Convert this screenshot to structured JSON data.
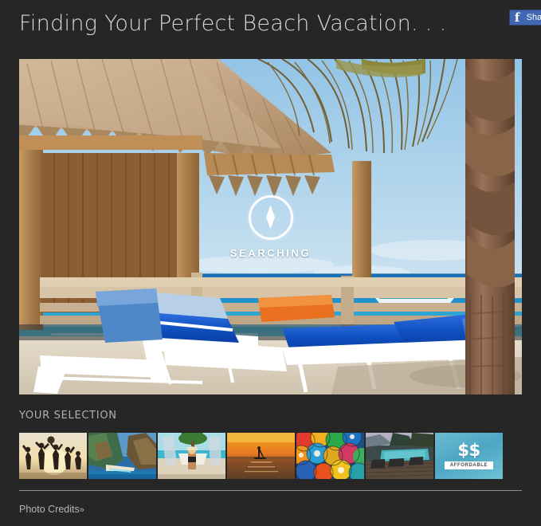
{
  "page": {
    "background_color": "#262626",
    "text_color": "#d8d8d8"
  },
  "header": {
    "title": "Finding Your Perfect Beach Vacation. . .",
    "share": {
      "network": "facebook",
      "icon_glyph": "f",
      "label": "Share"
    }
  },
  "hero": {
    "alt": "Thatched-roof beach cabana with blue and white lounge chairs, palm tree and cruise ship on turquoise Caribbean water",
    "status_overlay": {
      "icon": "compass-icon",
      "label": "SEARCHING"
    },
    "colors": {
      "sky": "#a8cfe8",
      "ocean_deep": "#1a7fc0",
      "ocean_shallow": "#44b9d8",
      "sand": "#ded3c2",
      "thatch": "#c3a583",
      "wood": "#b08352",
      "chair_blue": "#1156c4"
    }
  },
  "selection": {
    "heading": "YOUR SELECTION",
    "thumbnails": [
      {
        "name": "beach-volleyball",
        "caption": "Beach volleyball at sunset"
      },
      {
        "name": "coastal-cliffs",
        "caption": "Green sea cliffs and turquoise cove"
      },
      {
        "name": "hammock",
        "caption": "Woman relaxing in hammock on the beach"
      },
      {
        "name": "paddleboard-sunset",
        "caption": "Paddleboarder on golden sunset water"
      },
      {
        "name": "colorful-umbrellas",
        "caption": "Brightly painted umbrellas and art"
      },
      {
        "name": "resort-pool",
        "caption": "Resort pool and loungers at dusk"
      }
    ],
    "price_tile": {
      "name": "affordable-price",
      "symbol": "$$",
      "ribbon_label": "AFFORDABLE"
    }
  },
  "footer": {
    "photo_credits_label": "Photo Credits",
    "photo_credits_chevron": "»"
  }
}
